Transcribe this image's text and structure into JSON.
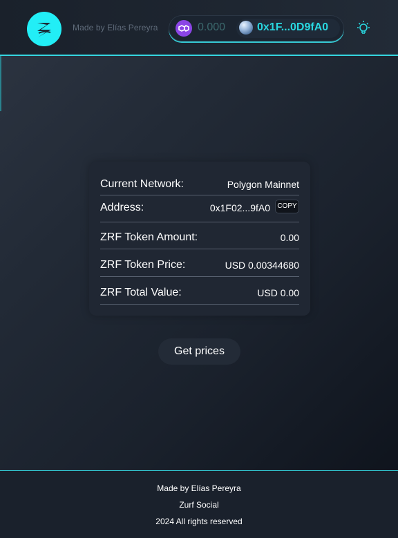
{
  "header": {
    "made_by": "Made by Elías Pereyra",
    "logo_icon": "zurf-logo-icon",
    "wallet": {
      "network_icon": "polygon-matic-icon",
      "balance": "0.000",
      "account_icon": "globe-avatar-icon",
      "address_short": "0x1F...0D9fA0"
    },
    "theme_icon": "lightbulb-icon"
  },
  "card": {
    "rows": [
      {
        "label": "Current Network:",
        "value": "Polygon Mainnet"
      },
      {
        "label": "Address:",
        "value": "0x1F02...9fA0",
        "action": "COPY"
      },
      {
        "label": "ZRF Token Amount:",
        "value": "0.00"
      },
      {
        "label": "ZRF Token Price:",
        "value": "USD 0.00344680"
      },
      {
        "label": "ZRF Total Value:",
        "value": "USD 0.00"
      }
    ]
  },
  "actions": {
    "get_prices": "Get prices"
  },
  "footer": {
    "line1": "Made by Elías Pereyra",
    "line2": "Zurf Social",
    "line3": "2024 All rights reserved"
  },
  "colors": {
    "accent": "#29d7e0",
    "logo_bg": "#22eef6",
    "matic": "#8b45e6",
    "card_bg": "#202733"
  }
}
